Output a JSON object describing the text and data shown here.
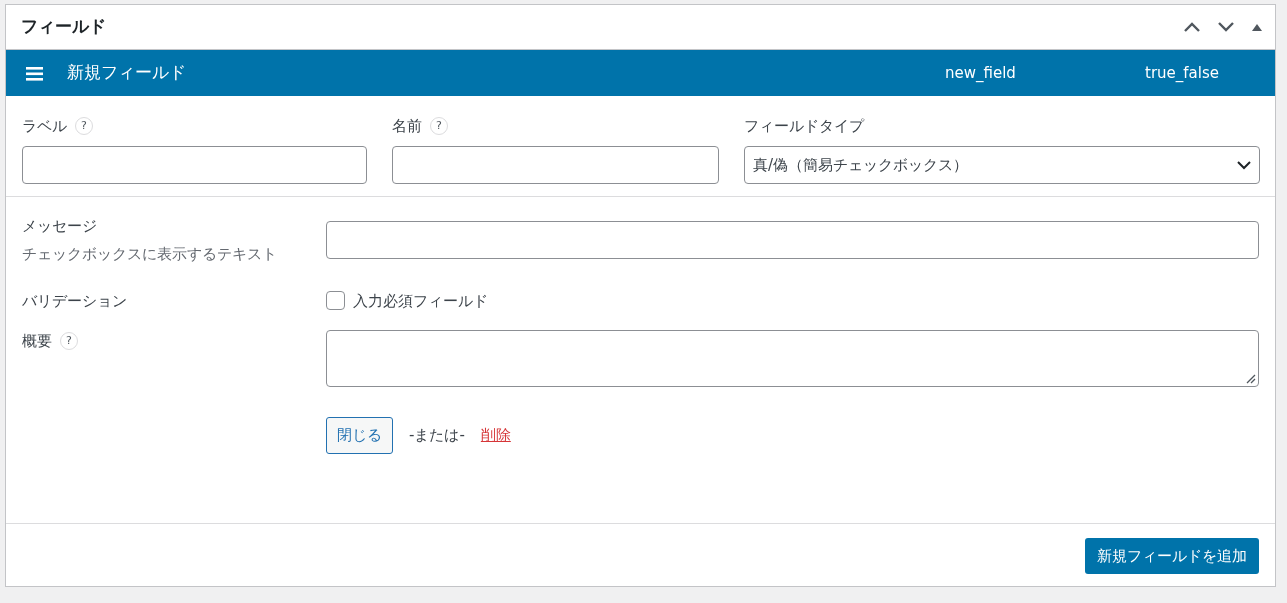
{
  "panel": {
    "title": "フィールド"
  },
  "field": {
    "title": "新規フィールド",
    "name": "new_field",
    "type": "true_false"
  },
  "top_fields": [
    {
      "kind": "text",
      "label": "ラベル",
      "help": "?"
    },
    {
      "kind": "text",
      "label": "名前",
      "help": "?"
    },
    {
      "kind": "select",
      "label": "フィールドタイプ",
      "value": "真/偽（簡易チェックボックス）"
    }
  ],
  "settings": [
    {
      "kind": "text",
      "label": "メッセージ",
      "description": "チェックボックスに表示するテキスト"
    },
    {
      "kind": "checkbox",
      "label": "バリデーション",
      "option": "入力必須フィールド",
      "checked": false
    },
    {
      "kind": "textarea",
      "label": "概要",
      "help": "?"
    }
  ],
  "actions": {
    "close": "閉じる",
    "or": "-または-",
    "delete": "削除"
  },
  "footer_button": "新規フィールドを追加"
}
